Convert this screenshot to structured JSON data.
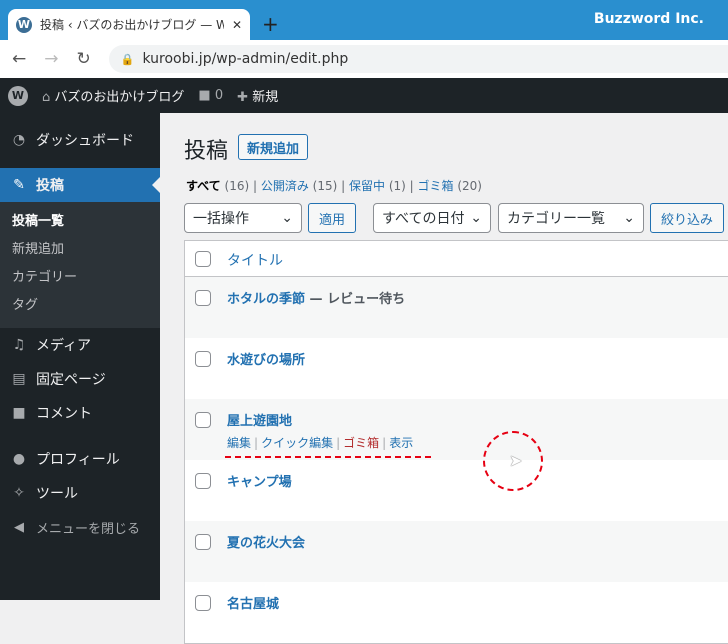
{
  "browser": {
    "tab_title": "投稿 ‹ バズのお出かけブログ — WordPress",
    "brand": "Buzzword Inc.",
    "url": "kuroobi.jp/wp-admin/edit.php"
  },
  "adminbar": {
    "site": "バズのお出かけブログ",
    "comments": "0",
    "new": "新規"
  },
  "sidebar": {
    "items": [
      {
        "label": "ダッシュボード"
      },
      {
        "label": "投稿"
      },
      {
        "label": "メディア"
      },
      {
        "label": "固定ページ"
      },
      {
        "label": "コメント"
      },
      {
        "label": "プロフィール"
      },
      {
        "label": "ツール"
      },
      {
        "label": "メニューを閉じる"
      }
    ],
    "submenu": [
      "投稿一覧",
      "新規追加",
      "カテゴリー",
      "タグ"
    ]
  },
  "main": {
    "title": "投稿",
    "add_new": "新規追加",
    "filters": [
      {
        "label": "すべて",
        "count": "(16)"
      },
      {
        "label": "公開済み",
        "count": "(15)"
      },
      {
        "label": "保留中",
        "count": "(1)"
      },
      {
        "label": "ゴミ箱",
        "count": "(20)"
      }
    ],
    "bulk": "一括操作",
    "apply": "適用",
    "dates": "すべての日付",
    "categories": "カテゴリー一覧",
    "filter": "絞り込み",
    "column_title": "タイトル",
    "posts": [
      "ホタルの季節",
      "水遊びの場所",
      "屋上遊園地",
      "キャンプ場",
      "夏の花火大会",
      "名古屋城"
    ],
    "post_state": " — レビュー待ち",
    "row_actions": {
      "edit": "編集",
      "quick_edit": "クイック編集",
      "trash": "ゴミ箱",
      "view": "表示"
    }
  }
}
